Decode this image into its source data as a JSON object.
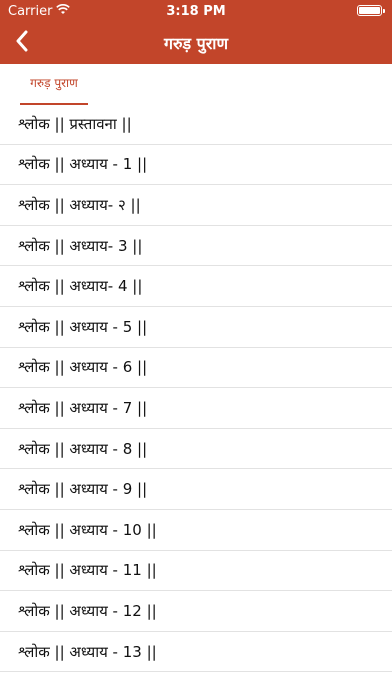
{
  "status_bar": {
    "carrier": "Carrier",
    "time": "3:18 PM"
  },
  "nav": {
    "title": "गरुड़ पुराण"
  },
  "tabs": [
    {
      "label": "गरुड़ पुराण"
    }
  ],
  "items": [
    {
      "label": "श्लोक || प्रस्तावना ||"
    },
    {
      "label": "श्लोक || अध्याय - 1 ||"
    },
    {
      "label": "श्लोक || अध्याय- २ ||"
    },
    {
      "label": "श्लोक || अध्याय- 3 ||"
    },
    {
      "label": "श्लोक || अध्याय- 4 ||"
    },
    {
      "label": "श्लोक || अध्याय - 5 ||"
    },
    {
      "label": "श्लोक || अध्याय - 6 ||"
    },
    {
      "label": "श्लोक || अध्याय - 7 ||"
    },
    {
      "label": "श्लोक || अध्याय - 8 ||"
    },
    {
      "label": "श्लोक || अध्याय - 9 ||"
    },
    {
      "label": "श्लोक || अध्याय - 10 ||"
    },
    {
      "label": "श्लोक || अध्याय - 11 ||"
    },
    {
      "label": "श्लोक || अध्याय - 12 ||"
    },
    {
      "label": "श्लोक || अध्याय - 13 ||"
    }
  ],
  "colors": {
    "accent": "#c2452a",
    "background": "#ffffff",
    "divider": "#e2e2e2"
  }
}
